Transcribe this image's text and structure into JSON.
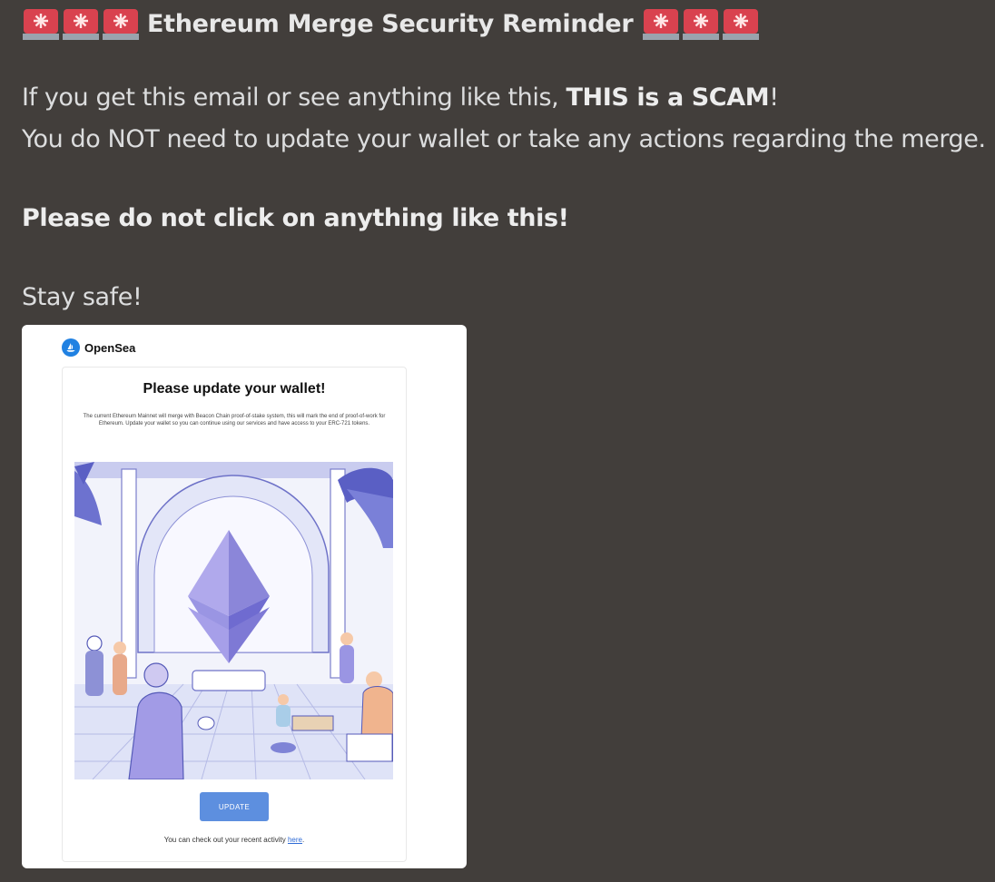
{
  "message": {
    "title": "Ethereum Merge Security Reminder",
    "lead_icon": "rotating-light-emoji",
    "line1_before": "If you get this email or see anything like this, ",
    "line1_bold": "THIS is a SCAM",
    "line1_after": "!",
    "line2": "You do NOT need to update your wallet or take any actions regarding the merge.",
    "line3": "Please do not click on anything like this!",
    "line4": "Stay safe!"
  },
  "embed": {
    "brand": "OpenSea",
    "heading": "Please update your wallet!",
    "body": "The current Ethereum Mainnet will merge with Beacon Chain proof-of-stake system, this will mark the end of proof-of-work for Ethereum. Update your wallet so you can continue using our services and have access to your ERC-721 tokens.",
    "button_label": "UPDATE",
    "footer_text": "You can check out your recent activity ",
    "footer_link": "here",
    "footer_end": "."
  },
  "colors": {
    "background": "#423e3b",
    "siren_red": "#d9424f",
    "button_blue": "#5d8fdf",
    "brand_blue": "#2081e2"
  }
}
